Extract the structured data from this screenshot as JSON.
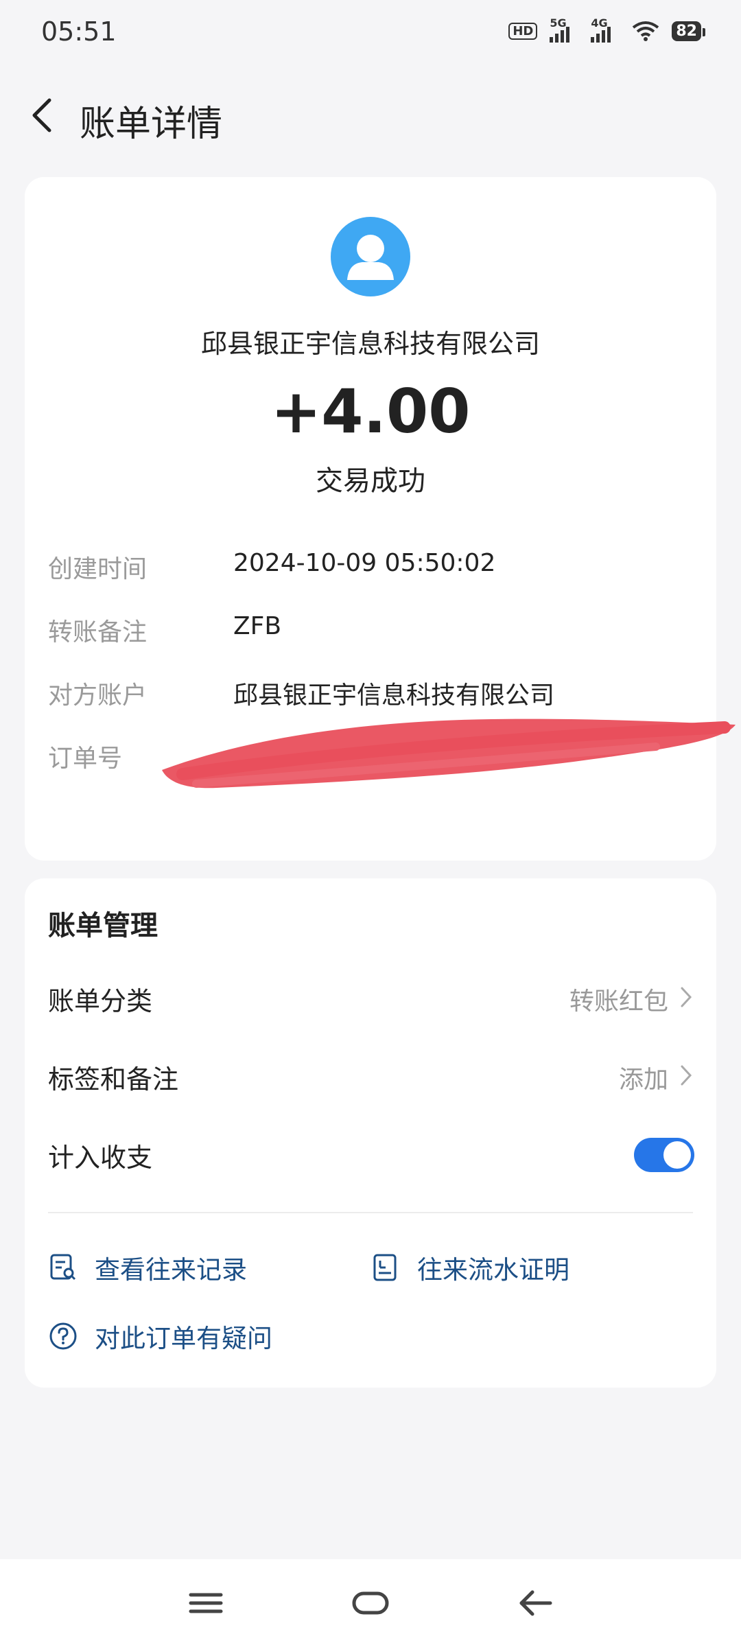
{
  "status_bar": {
    "time": "05:51",
    "hd_label": "HD",
    "signal1_label": "5G",
    "signal2_label": "4G",
    "battery": "82"
  },
  "header": {
    "title": "账单详情"
  },
  "summary": {
    "payee": "邱县银正宇信息科技有限公司",
    "amount": "+4.00",
    "status": "交易成功"
  },
  "details": [
    {
      "label": "创建时间",
      "value": "2024-10-09 05:50:02"
    },
    {
      "label": "转账备注",
      "value": "ZFB"
    },
    {
      "label": "对方账户",
      "value": "邱县银正宇信息科技有限公司"
    },
    {
      "label": "订单号",
      "value": ""
    }
  ],
  "management": {
    "title": "账单管理",
    "category_label": "账单分类",
    "category_value": "转账红包",
    "tags_label": "标签和备注",
    "tags_value": "添加",
    "count_label": "计入收支",
    "count_enabled": true
  },
  "links": {
    "records": "查看往来记录",
    "proof": "往来流水证明",
    "question": "对此订单有疑问"
  },
  "colors": {
    "accent": "#2676e8",
    "link": "#1c4f86",
    "avatar": "#3fa8f3",
    "redaction": "#e94f5c"
  }
}
